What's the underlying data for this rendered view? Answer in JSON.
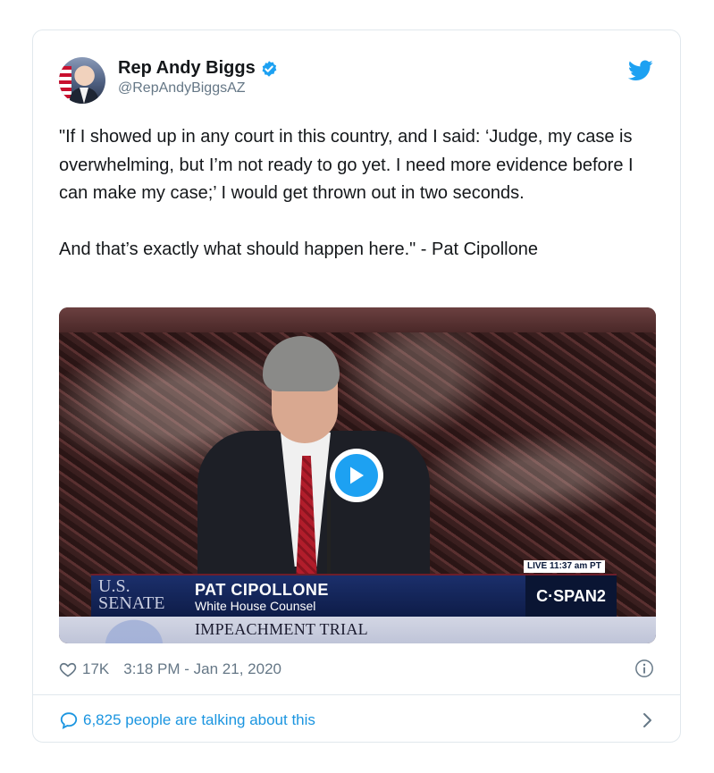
{
  "author": {
    "name": "Rep Andy Biggs",
    "handle": "@RepAndyBiggsAZ",
    "verified": true
  },
  "tweet": {
    "paragraphs": [
      "\"If I showed up in any court in this country, and I said: ‘Judge, my case is overwhelming, but I’m not ready to go yet. I need more evidence before I can make my case;’ I would get thrown out in two seconds.",
      "And that’s exactly what should happen here.\" - Pat Cipollone"
    ]
  },
  "media": {
    "live_label": "LIVE 11:37 am PT",
    "senate_label_line1": "U.S.",
    "senate_label_line2": "SENATE",
    "chyron_name": "PAT CIPOLLONE",
    "chyron_title": "White House Counsel",
    "network": "C·SPAN2",
    "bottom_bar": "IMPEACHMENT TRIAL"
  },
  "meta": {
    "likes": "17K",
    "timestamp": "3:18 PM - Jan 21, 2020"
  },
  "footer": {
    "talking_text": "6,825 people are talking about this"
  },
  "colors": {
    "accent": "#1da1f2",
    "link": "#1b95e0",
    "muted": "#657786"
  },
  "icons": [
    "verified-badge-icon",
    "twitter-bird-icon",
    "play-icon",
    "heart-icon",
    "info-icon",
    "speech-bubble-icon",
    "chevron-right-icon"
  ]
}
